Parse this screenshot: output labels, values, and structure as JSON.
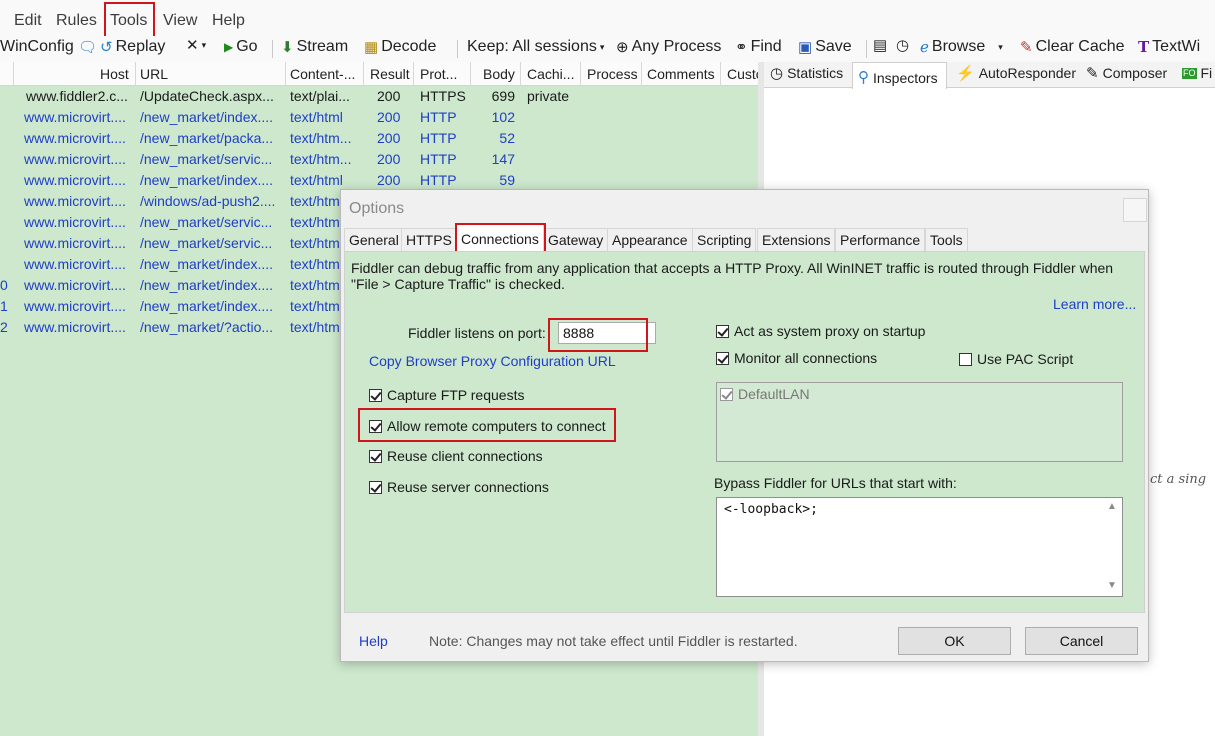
{
  "menu": {
    "items": [
      "Edit",
      "Rules",
      "Tools",
      "View",
      "Help"
    ]
  },
  "toolbar": {
    "winconfig": "WinConfig",
    "replay": "Replay",
    "go": "Go",
    "stream": "Stream",
    "decode": "Decode",
    "keep": "Keep: All sessions",
    "any_process": "Any Process",
    "find": "Find",
    "save": "Save",
    "browse": "Browse",
    "clear_cache": "Clear Cache",
    "textwizard": "TextWi"
  },
  "session_columns": [
    "Host",
    "URL",
    "Content-...",
    "Result",
    "Prot...",
    "Body",
    "Cachi...",
    "Process",
    "Comments",
    "Custo"
  ],
  "sessions": [
    {
      "num": "",
      "host": "www.fiddler2.c...",
      "url": "/UpdateCheck.aspx...",
      "content": "text/plai...",
      "result": "200",
      "protocol": "HTTPS",
      "body": "699",
      "caching": "private",
      "style": "black"
    },
    {
      "num": "",
      "host": "www.microvirt....",
      "url": "/new_market/index....",
      "content": "text/html",
      "result": "200",
      "protocol": "HTTP",
      "body": "102",
      "caching": "",
      "style": "blue"
    },
    {
      "num": "",
      "host": "www.microvirt....",
      "url": "/new_market/packa...",
      "content": "text/htm...",
      "result": "200",
      "protocol": "HTTP",
      "body": "52",
      "caching": "",
      "style": "blue"
    },
    {
      "num": "",
      "host": "www.microvirt....",
      "url": "/new_market/servic...",
      "content": "text/htm...",
      "result": "200",
      "protocol": "HTTP",
      "body": "147",
      "caching": "",
      "style": "blue"
    },
    {
      "num": "",
      "host": "www.microvirt....",
      "url": "/new_market/index....",
      "content": "text/html",
      "result": "200",
      "protocol": "HTTP",
      "body": "59",
      "caching": "",
      "style": "blue"
    },
    {
      "num": "",
      "host": "www.microvirt....",
      "url": "/windows/ad-push2....",
      "content": "text/htm",
      "result": "",
      "protocol": "",
      "body": "",
      "caching": "",
      "style": "blue"
    },
    {
      "num": "",
      "host": "www.microvirt....",
      "url": "/new_market/servic...",
      "content": "text/htm",
      "result": "",
      "protocol": "",
      "body": "",
      "caching": "",
      "style": "blue"
    },
    {
      "num": "",
      "host": "www.microvirt....",
      "url": "/new_market/servic...",
      "content": "text/htm",
      "result": "",
      "protocol": "",
      "body": "",
      "caching": "",
      "style": "blue"
    },
    {
      "num": "",
      "host": "www.microvirt....",
      "url": "/new_market/index....",
      "content": "text/htm",
      "result": "",
      "protocol": "",
      "body": "",
      "caching": "",
      "style": "blue"
    },
    {
      "num": "0",
      "host": "www.microvirt....",
      "url": "/new_market/index....",
      "content": "text/htm",
      "result": "",
      "protocol": "",
      "body": "",
      "caching": "",
      "style": "blue"
    },
    {
      "num": "1",
      "host": "www.microvirt....",
      "url": "/new_market/index....",
      "content": "text/htm",
      "result": "",
      "protocol": "",
      "body": "",
      "caching": "",
      "style": "blue"
    },
    {
      "num": "2",
      "host": "www.microvirt....",
      "url": "/new_market/?actio...",
      "content": "text/htm",
      "result": "",
      "protocol": "",
      "body": "",
      "caching": "",
      "style": "blue"
    }
  ],
  "right_tabs": {
    "statistics": "Statistics",
    "inspectors": "Inspectors",
    "autoresponder": "AutoResponder",
    "composer": "Composer",
    "fiddler_orchestra": "Fi"
  },
  "right_pane_text": "ct a sing",
  "dialog": {
    "title": "Options",
    "tabs": [
      "General",
      "HTTPS",
      "Connections",
      "Gateway",
      "Appearance",
      "Scripting",
      "Extensions",
      "Performance",
      "Tools"
    ],
    "active_tab": "Connections",
    "description": "Fiddler can debug traffic from any application that accepts a HTTP Proxy. All WinINET traffic is routed through Fiddler when",
    "description_line2": "\"File > Capture Traffic\" is checked.",
    "learn_more": "Learn more...",
    "port_label": "Fiddler listens on port:",
    "port_value": "8888",
    "copy_url": "Copy Browser Proxy Configuration URL",
    "capture_ftp": "Capture FTP requests",
    "allow_remote": "Allow remote computers to connect",
    "reuse_client": "Reuse client connections",
    "reuse_server": "Reuse server connections",
    "act_as_proxy": "Act as system proxy on startup",
    "monitor_all": "Monitor all connections",
    "use_pac": "Use PAC Script",
    "default_lan": "DefaultLAN",
    "bypass_label": "Bypass Fiddler for URLs that start with:",
    "bypass_value": "<-loopback>;",
    "help": "Help",
    "note": "Note: Changes may not take effect until Fiddler is restarted.",
    "ok": "OK",
    "cancel": "Cancel"
  }
}
